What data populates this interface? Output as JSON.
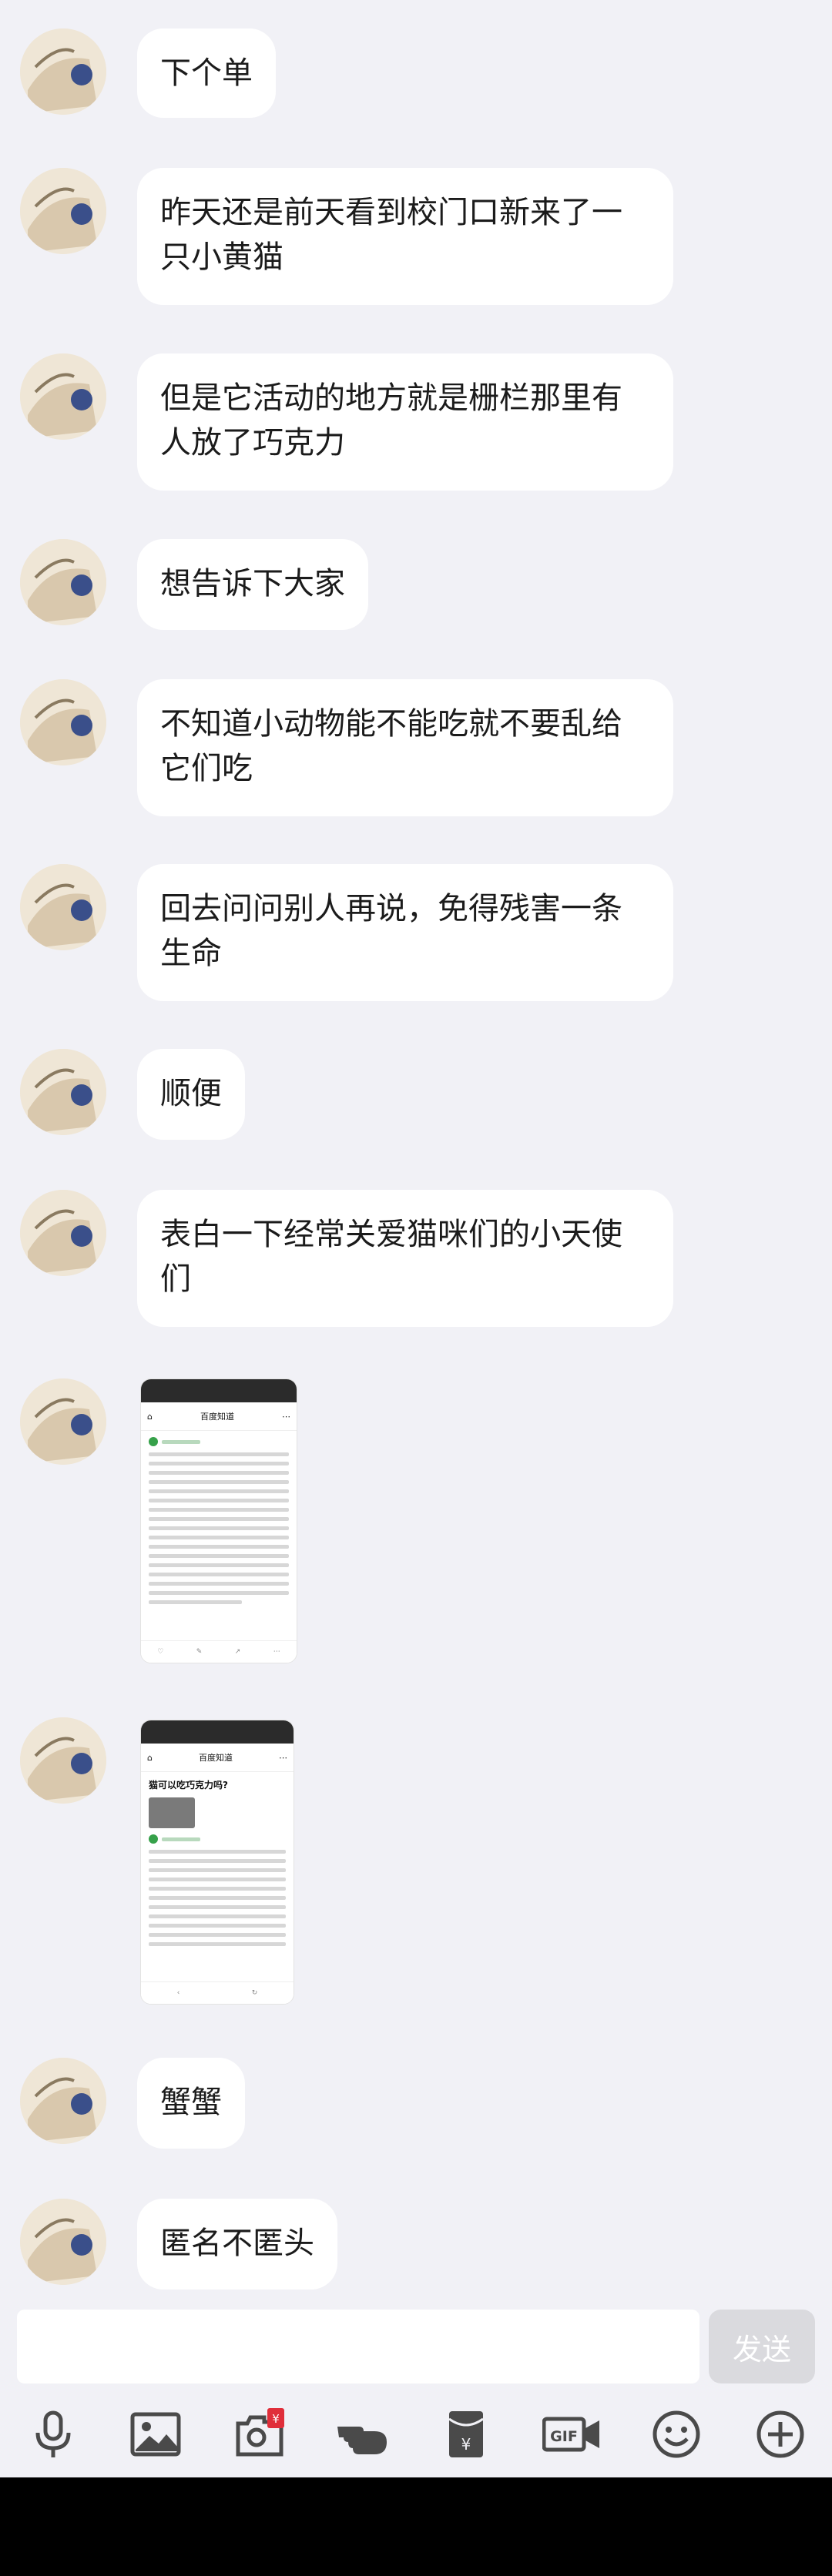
{
  "messages": [
    {
      "type": "text",
      "text": "下个单"
    },
    {
      "type": "text",
      "text": "昨天还是前天看到校门口新来了一只小黄猫"
    },
    {
      "type": "text",
      "text": "但是它活动的地方就是栅栏那里有人放了巧克力"
    },
    {
      "type": "text",
      "text": "想告诉下大家"
    },
    {
      "type": "text",
      "text": "不知道小动物能不能吃就不要乱给它们吃"
    },
    {
      "type": "text",
      "text": "回去问问别人再说，免得残害一条生命"
    },
    {
      "type": "text",
      "text": "顺便"
    },
    {
      "type": "text",
      "text": "表白一下经常关爱猫咪们的小天使们"
    },
    {
      "type": "image",
      "title": "百度知道"
    },
    {
      "type": "image",
      "title": "百度知道",
      "question": "猫可以吃巧克力吗?"
    },
    {
      "type": "text",
      "text": "蟹蟹"
    },
    {
      "type": "text",
      "text": "匿名不匿头"
    }
  ],
  "input": {
    "placeholder": "",
    "send_label": "发送"
  },
  "toolbar": {
    "icons": [
      "microphone-icon",
      "image-icon",
      "red-packet-camera-icon",
      "poke-icon",
      "red-envelope-icon",
      "gif-icon",
      "emoji-icon",
      "plus-icon"
    ],
    "red_packet_badge": "¥",
    "gif_label": "GIF"
  },
  "colors": {
    "background": "#f1f1f6",
    "bubble": "#ffffff",
    "send_disabled": "#dadade",
    "icon": "#4a4a4a"
  }
}
